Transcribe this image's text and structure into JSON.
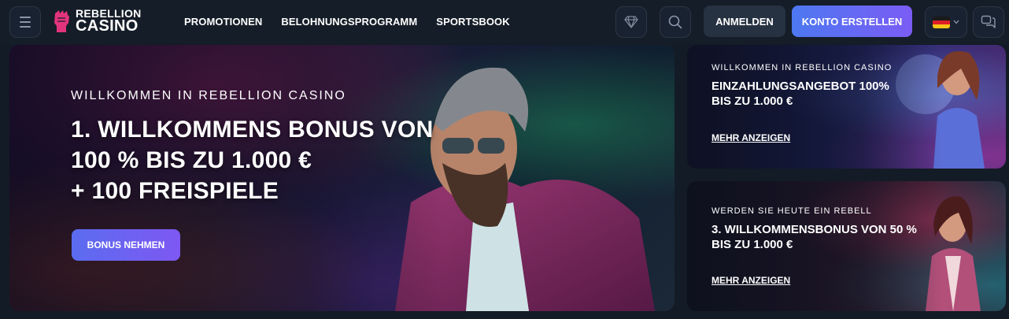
{
  "header": {
    "logo": {
      "top": "REBELLION",
      "bottom": "CASINO"
    },
    "nav": [
      "PROMOTIONEN",
      "BELOHNUNGSPROGRAMM",
      "SPORTSBOOK"
    ],
    "login_label": "ANMELDEN",
    "register_label": "KONTO ERSTELLEN",
    "icons": {
      "menu": "hamburger-icon",
      "rewards": "diamond-icon",
      "search": "search-icon",
      "chat": "chat-icon",
      "language": "german-flag-icon"
    }
  },
  "hero": {
    "eyebrow": "WILLKOMMEN IN REBELLION CASINO",
    "title_lines": [
      "1. WILLKOMMENS BONUS VON",
      "100 % BIS ZU 1.000 €",
      "+ 100 FREISPIELE"
    ],
    "cta": "BONUS NEHMEN"
  },
  "cards": [
    {
      "eyebrow": "WILLKOMMEN IN REBELLION CASINO",
      "title_lines": [
        "EINZAHLUNGSANGEBOT 100%",
        "BIS ZU 1.000 €"
      ],
      "link": "MEHR ANZEIGEN"
    },
    {
      "eyebrow": "WERDEN SIE HEUTE EIN REBELL",
      "title_lines": [
        "3. WILLKOMMENSBONUS VON 50 %",
        "BIS ZU 1.000 €"
      ],
      "link": "MEHR ANZEIGEN"
    }
  ],
  "colors": {
    "background": "#131b26",
    "accent_start": "#4d78f2",
    "accent_end": "#7b5cf4",
    "logo_pink": "#e2347c"
  }
}
